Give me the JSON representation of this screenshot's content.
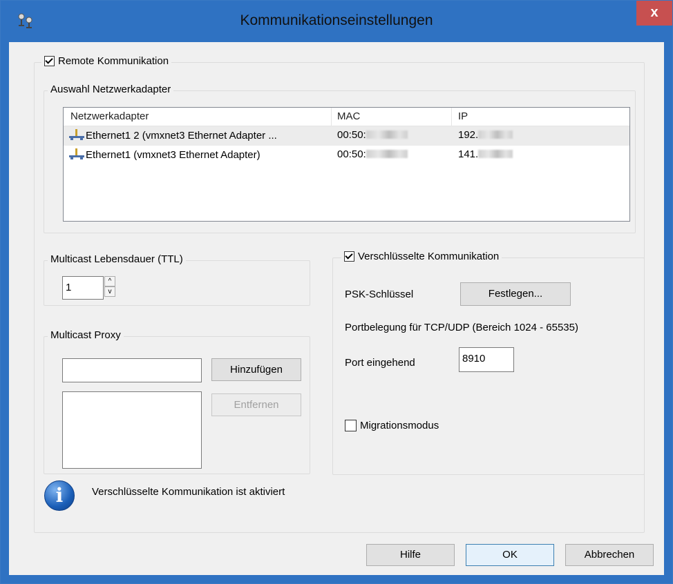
{
  "window": {
    "title": "Kommunikationseinstellungen",
    "close_label": "x"
  },
  "remote": {
    "label": "Remote Kommunikation",
    "checked": true
  },
  "adapter_group": {
    "title": "Auswahl Netzwerkadapter",
    "columns": [
      "Netzwerkadapter",
      "MAC",
      "IP"
    ],
    "rows": [
      {
        "name": "Ethernet1 2 (vmxnet3 Ethernet Adapter ...",
        "mac_prefix": "00:50:",
        "ip_prefix": "192.",
        "selected": true
      },
      {
        "name": "Ethernet1 (vmxnet3 Ethernet Adapter)",
        "mac_prefix": "00:50:",
        "ip_prefix": "141.",
        "selected": false
      }
    ]
  },
  "ttl_group": {
    "title": "Multicast Lebensdauer (TTL)",
    "value": "1",
    "up_glyph": "^",
    "down_glyph": "v"
  },
  "proxy_group": {
    "title": "Multicast Proxy",
    "input_value": "",
    "add_label": "Hinzufügen",
    "remove_label": "Entfernen"
  },
  "encryption_group": {
    "label": "Verschlüsselte  Kommunikation",
    "checked": true,
    "psk_label": "PSK-Schlüssel",
    "psk_button": "Festlegen...",
    "port_info": "Portbelegung für TCP/UDP (Bereich 1024 - 65535)",
    "port_label": "Port eingehend",
    "port_value": "8910",
    "migration_label": "Migrationsmodus",
    "migration_checked": false
  },
  "status": {
    "icon": "info-icon",
    "icon_glyph": "i",
    "message": "Verschlüsselte Kommunikation ist aktiviert"
  },
  "footer": {
    "help_label": "Hilfe",
    "ok_label": "OK",
    "cancel_label": "Abbrechen"
  },
  "colors": {
    "title_bar": "#2f72c2",
    "close_button": "#c75050",
    "dialog_bg": "#f0f0f0"
  }
}
